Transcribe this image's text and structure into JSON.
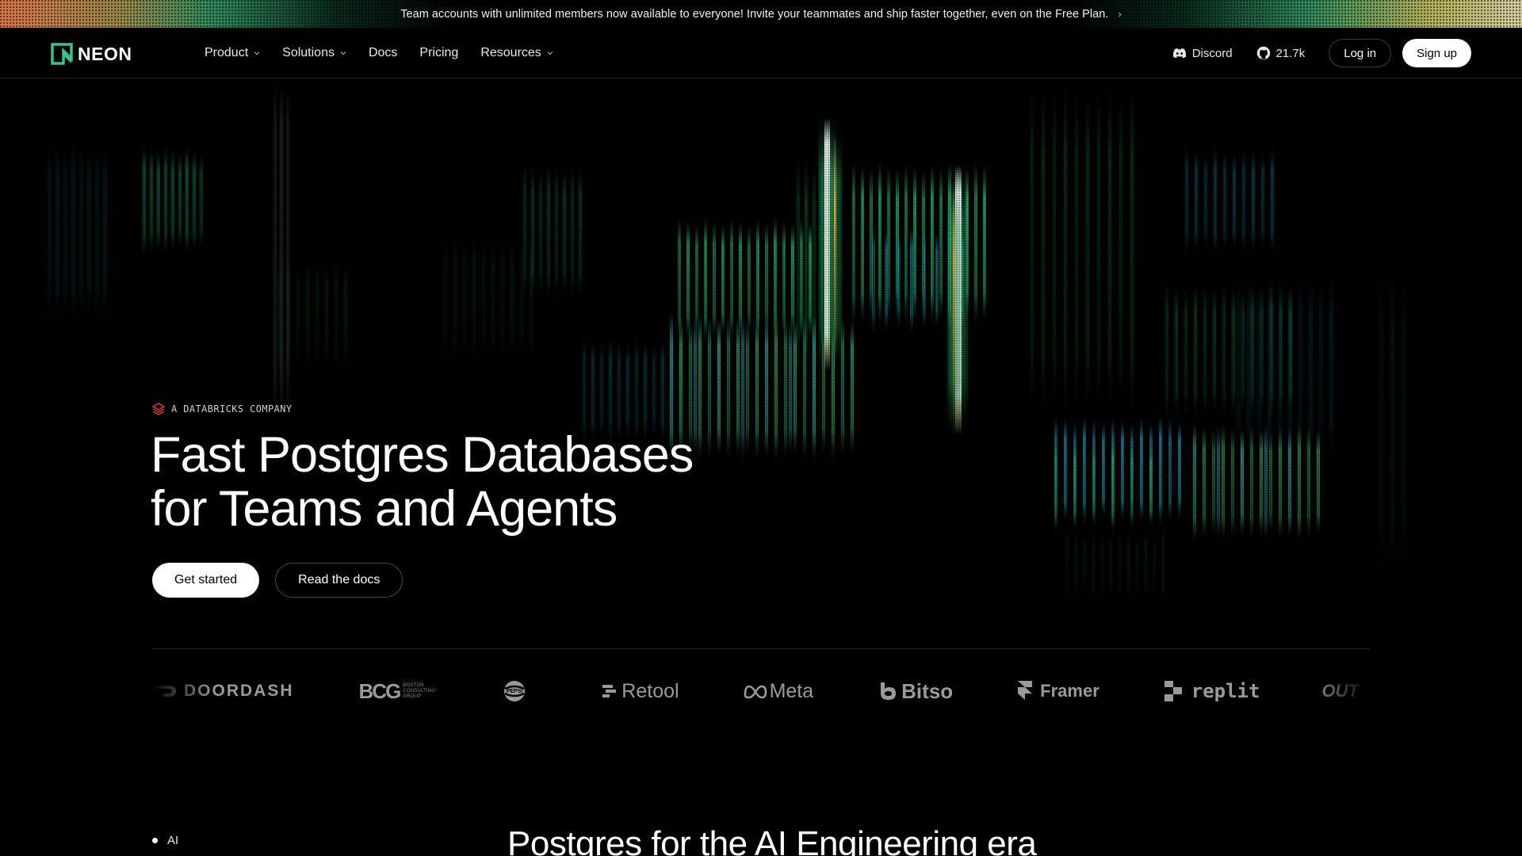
{
  "banner": {
    "text": "Team accounts with unlimited members now available to everyone! Invite your teammates and ship faster together, even on the Free Plan.",
    "chevron": "›"
  },
  "nav": {
    "logo_text": "NEON",
    "menu": [
      {
        "label": "Product",
        "has_dropdown": true
      },
      {
        "label": "Solutions",
        "has_dropdown": true
      },
      {
        "label": "Docs",
        "has_dropdown": false
      },
      {
        "label": "Pricing",
        "has_dropdown": false
      },
      {
        "label": "Resources",
        "has_dropdown": true
      }
    ],
    "discord_label": "Discord",
    "github_stars": "21.7k",
    "login_label": "Log in",
    "signup_label": "Sign up"
  },
  "hero": {
    "company_badge": "A DATABRICKS COMPANY",
    "headline_line1": "Fast Postgres Databases",
    "headline_line2": "for Teams and Agents",
    "primary_cta": "Get started",
    "secondary_cta": "Read the docs"
  },
  "logos": [
    "DOORDASH",
    "BCG",
    "PEPSI",
    "Retool",
    "Meta",
    "Bitso",
    "Framer",
    "replit",
    "OUT"
  ],
  "logo_subtext": {
    "bcg": "BOSTON CONSULTING GROUP"
  },
  "section": {
    "tag": "AI",
    "title": "Postgres for the AI Engineering era"
  },
  "colors": {
    "accent": "#37c38f",
    "background": "#000000",
    "banner_left": "#e0784a",
    "banner_right": "#d8d0a0",
    "databricks": "#e0402f"
  },
  "icons": [
    "neon-logo-icon",
    "chevron-down-icon",
    "discord-icon",
    "github-icon",
    "databricks-icon",
    "chevron-right-icon"
  ]
}
